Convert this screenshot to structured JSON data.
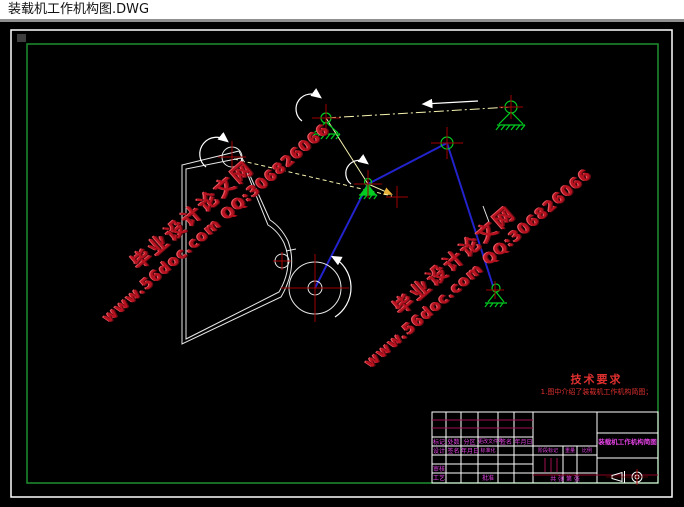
{
  "window": {
    "title": "装载机工作机构图.DWG"
  },
  "colors": {
    "background": "#000000",
    "sheet_border": "#ffffff",
    "inner_frame": "#1f8f2f",
    "mechanism_green": "#00cc22",
    "link_blue": "#2323cd",
    "construction_yellow": "#f7f3b0",
    "center_mark_red": "#a00000",
    "watermark_red": "#b81220",
    "table_text_magenta": "#e342e3",
    "tech_req_red": "#e03030"
  },
  "watermark": {
    "site_name": "毕业设计论文网",
    "url": "www.56doc.com",
    "qq": "QQ:306826066"
  },
  "tech_requirements": {
    "heading": "技术要求",
    "item": "1.图中介绍了装载机工作机构简图；"
  },
  "title_block": {
    "drawing_name": "装载机工作机构简图",
    "rev_headers": [
      "标记",
      "处数",
      "分区",
      "更改文件号",
      "签名",
      "年月日"
    ],
    "role_design": "设计",
    "role_sign": "签名",
    "role_date": "年月日",
    "role_standard": "标准化",
    "role_check": "审核",
    "role_process": "工艺",
    "role_approve": "批准",
    "stage_label": "阶段标记",
    "weight_label": "重量",
    "scale_label": "比例",
    "sheet_label": "共 张 第 张"
  },
  "icons": {
    "projection_symbol": "first-angle-projection",
    "arrows": [
      "rotation-arc-arrow",
      "direction-arrow"
    ]
  }
}
